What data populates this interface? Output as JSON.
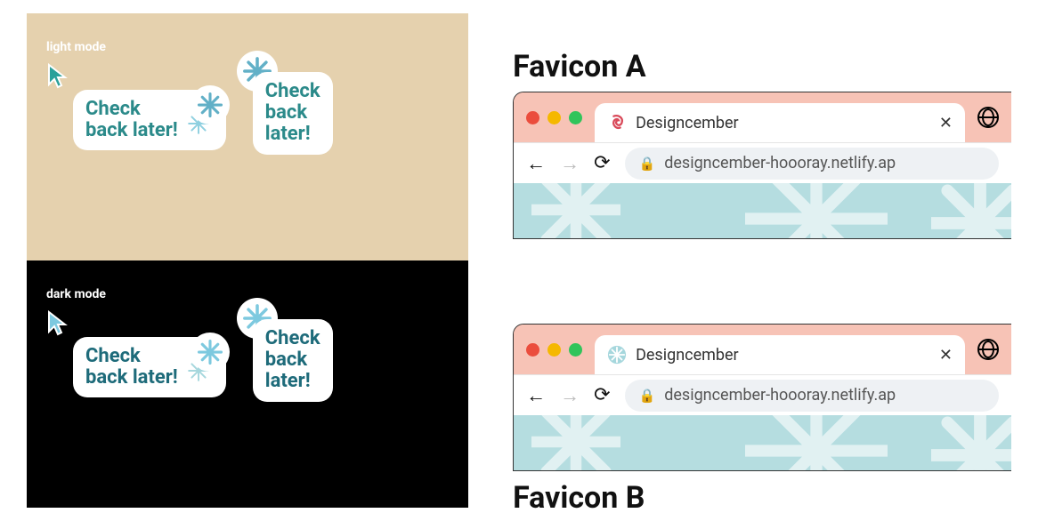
{
  "left": {
    "light_label": "light mode",
    "dark_label": "dark mode",
    "tooltip_line1": "Check",
    "tooltip_line2": "back later!",
    "tooltip_alt_line1": "Check",
    "tooltip_alt_line2": "back",
    "tooltip_alt_line3": "later!"
  },
  "right": {
    "favicon_a_label": "Favicon A",
    "favicon_b_label": "Favicon B",
    "tab_title": "Designcember",
    "url": "designcember-hoooray.netlify.ap",
    "colors": {
      "tabbar_bg": "#f7c3b6",
      "content_bg": "#b5dde0",
      "favicon_a": "#d94a5a",
      "favicon_b_bg": "#a6d7dd"
    }
  }
}
